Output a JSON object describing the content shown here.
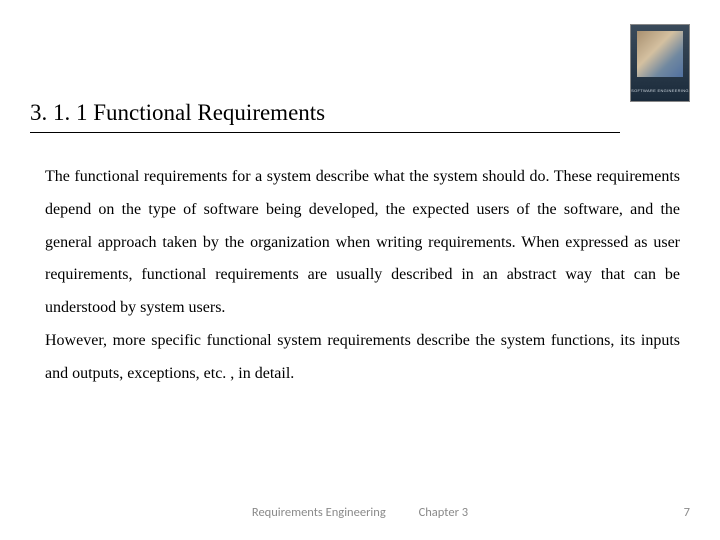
{
  "header": {
    "title": "3. 1. 1 Functional Requirements",
    "book_label": "SOFTWARE ENGINEERING"
  },
  "body": {
    "paragraph1": "The functional requirements for a system describe what the system should do. These requirements depend on the type of software being developed, the expected users of the software, and the general approach taken by the organization when writing requirements. When expressed as user requirements, functional requirements are usually described in an abstract way that can be understood by system users.",
    "paragraph2": "However, more specific functional system requirements describe the system functions, its inputs and outputs, exceptions, etc. , in detail."
  },
  "footer": {
    "left": "Requirements Engineering",
    "chapter": "Chapter 3",
    "page": "7"
  }
}
